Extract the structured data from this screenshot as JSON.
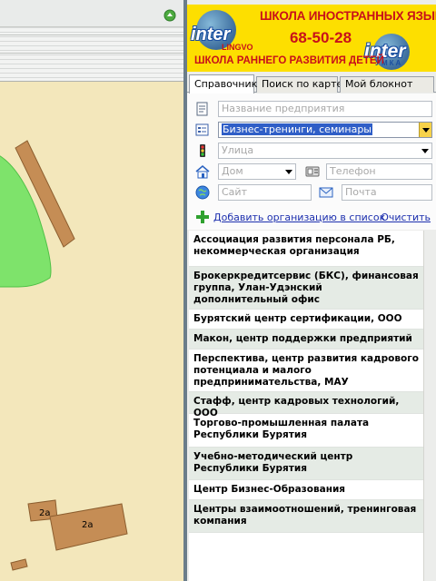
{
  "ad": {
    "line1": "ШКОЛА ИНОСТРАННЫХ ЯЗЫКОВ",
    "phone": "68-50-28",
    "line3": "ШКОЛА РАННЕГО РАЗВИТИЯ ДЕТЕЙ",
    "logo_left": "inter",
    "logo_left_sub": "LINGVO",
    "logo_right": "inter",
    "logo_right_sub": "УМКА",
    "bg_color": "#fddf00",
    "text_color": "#c8101a"
  },
  "tabs": [
    {
      "label": "Справочник",
      "active": true
    },
    {
      "label": "Поиск по карте",
      "active": false
    },
    {
      "label": "Мой блокнот",
      "active": false
    }
  ],
  "form": {
    "company_placeholder": "Название предприятия",
    "category_value": "Бизнес-тренинги, семинары",
    "street_placeholder": "Улица",
    "house_placeholder": "Дом",
    "phone_placeholder": "Телефон",
    "site_placeholder": "Сайт",
    "email_placeholder": "Почта",
    "add_link": "Добавить организацию в список",
    "clear_link": "Очистить"
  },
  "results": [
    "Ассоциация развития персонала РБ, некоммерческая организация",
    "Брокеркредитсервис (БКС), финансовая группа, Улан-Удэнский дополнительный офис",
    "Бурятский центр сертификации, ООО",
    "Макон, центр поддержки предприятий",
    "Перспектива, центр развития кадрового потенциала и малого предпринимательства, МАУ",
    "Стафф, центр кадровых технологий, ООО",
    "Торгово-промышленная палата Республики Бурятия",
    "Учебно-методический центр Республики Бурятия",
    "Центр Бизнес-Образования",
    "Центры взаимоотношений, тренинговая компания"
  ],
  "map": {
    "building_labels": [
      "2а",
      "2а"
    ],
    "background_color": "#f3e7bb",
    "park_color": "#7ee36b",
    "building_color": "#c58d55"
  },
  "icons": [
    "refresh-icon",
    "company-icon",
    "category-icon",
    "traffic-light-icon",
    "house-icon",
    "phone-icon",
    "globe-icon",
    "mail-icon",
    "plus-icon"
  ]
}
